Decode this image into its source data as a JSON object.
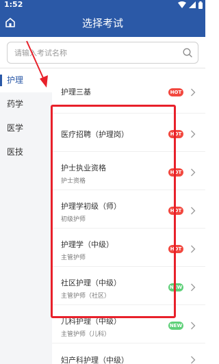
{
  "status_bar": {
    "time": "1:52"
  },
  "header": {
    "title": "选择考试"
  },
  "search": {
    "placeholder": "请输入考试名称"
  },
  "sidebar": {
    "items": [
      {
        "label": "护理",
        "active": true
      },
      {
        "label": "药学",
        "active": false
      },
      {
        "label": "医学",
        "active": false
      },
      {
        "label": "医技",
        "active": false
      }
    ]
  },
  "exams": [
    {
      "name": "护理三基",
      "sub": "",
      "badge": "HOT"
    },
    {
      "name": "医疗招聘（护理岗）",
      "sub": "",
      "badge": "HOT"
    },
    {
      "name": "护士执业资格",
      "sub": "护士资格",
      "badge": "HOT"
    },
    {
      "name": "护理学初级（师）",
      "sub": "初级护师",
      "badge": "HOT"
    },
    {
      "name": "护理学（中级）",
      "sub": "主管护师",
      "badge": "HOT"
    },
    {
      "name": "社区护理（中级）",
      "sub": "主管护师（社区）",
      "badge": "NEW"
    },
    {
      "name": "儿科护理（中级）",
      "sub": "主管护师（儿科）",
      "badge": "NEW"
    },
    {
      "name": "妇产科护理（中级）",
      "sub": "",
      "badge": ""
    }
  ],
  "colors": {
    "primary": "#2b59a7",
    "hot_badge": "#f2483f",
    "new_badge": "#5fd079",
    "annotation": "#e8202a"
  }
}
